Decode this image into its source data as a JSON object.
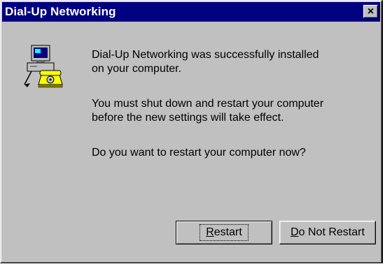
{
  "window": {
    "title": "Dial-Up Networking",
    "close_glyph": "×"
  },
  "icon": {
    "name": "dialup-computer-phone-icon"
  },
  "messages": {
    "line1a": "Dial-Up Networking was successfully installed",
    "line1b": "on your computer.",
    "line2a": "You must shut down and restart your computer",
    "line2b": "before the new settings will take effect.",
    "line3": "Do you want to restart your computer now?"
  },
  "buttons": {
    "restart": {
      "mnemonic": "R",
      "rest": "estart"
    },
    "do_not_restart": {
      "mnemonic": "D",
      "rest": "o Not Restart"
    }
  },
  "colors": {
    "titlebar": "#000080",
    "face": "#c0c0c0"
  }
}
